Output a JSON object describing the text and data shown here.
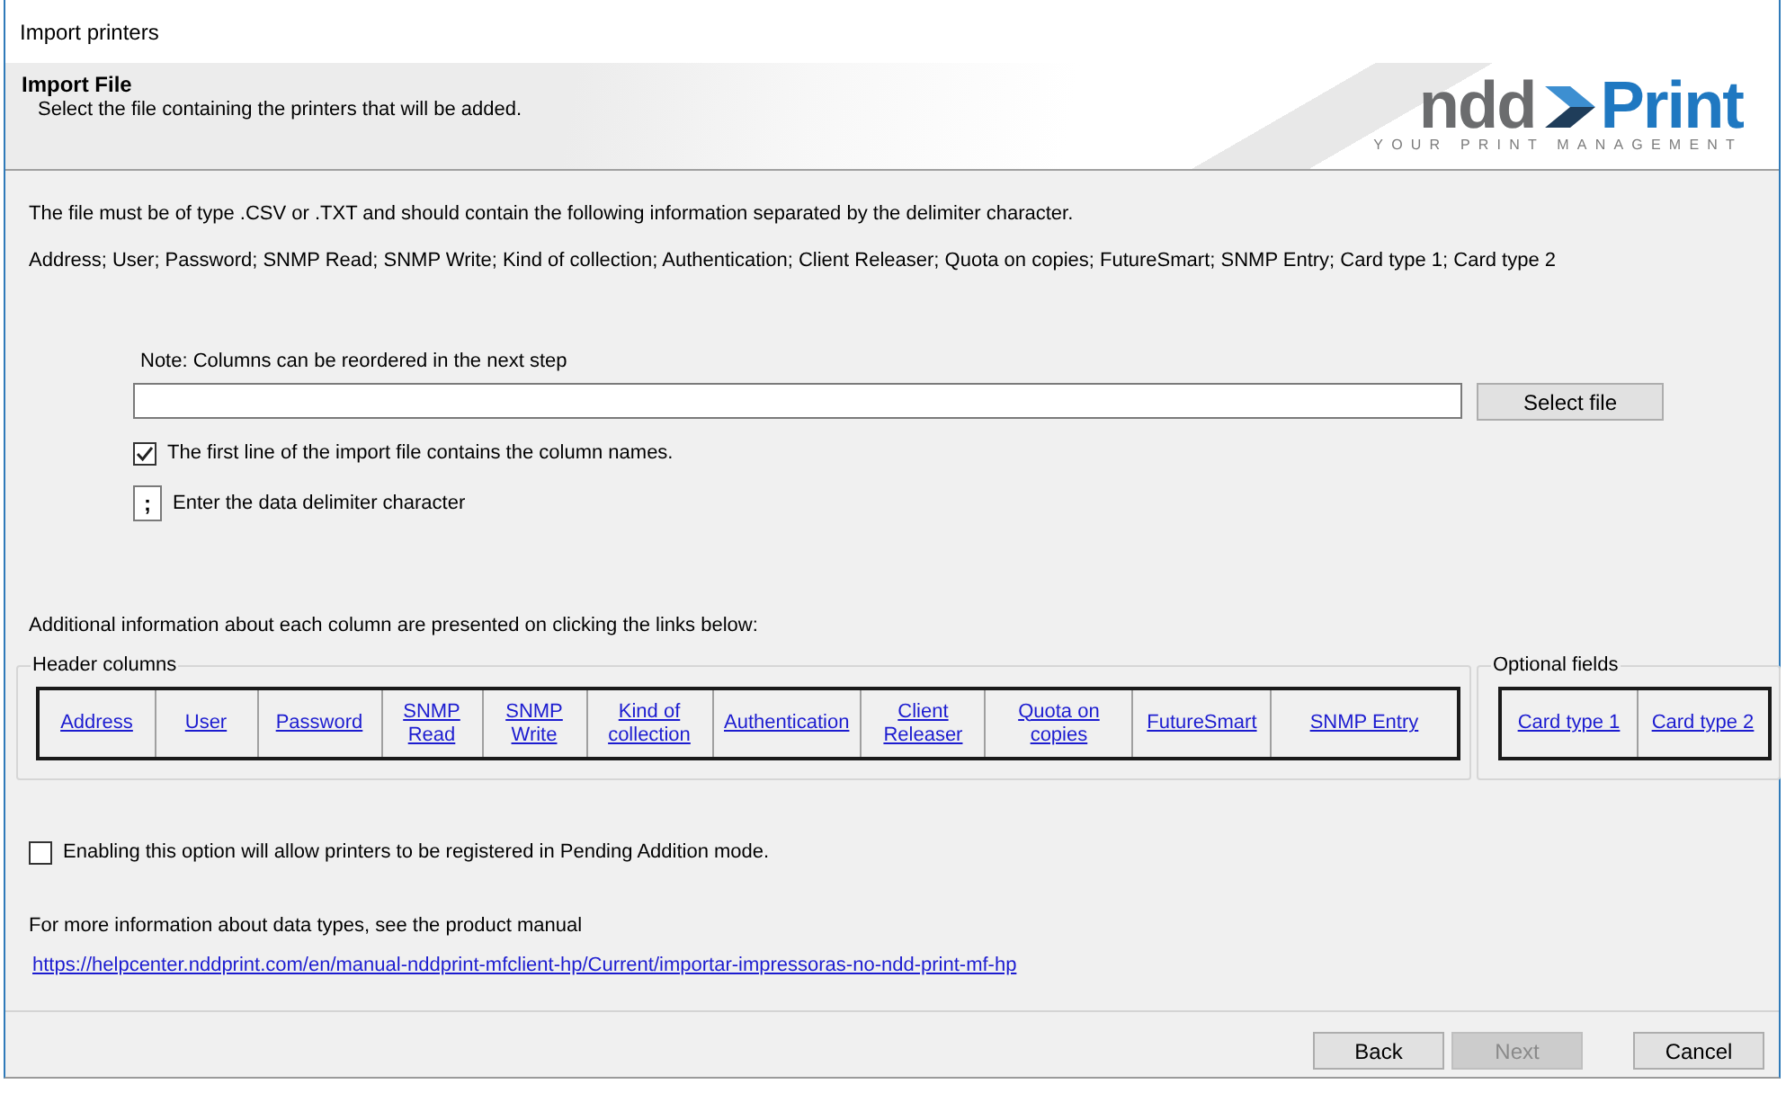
{
  "window": {
    "title": "Import printers"
  },
  "header": {
    "title": "Import File",
    "subtitle": "Select the file containing the printers that will be added.",
    "logo": {
      "word_1": "ndd",
      "word_2": "Print",
      "tagline": "YOUR PRINT MANAGEMENT"
    }
  },
  "intro": {
    "requirement": "The file must be of type .CSV or .TXT and should contain the following information separated by the delimiter character.",
    "fields_list": "Address; User; Password; SNMP Read; SNMP Write; Kind of collection; Authentication; Client Releaser; Quota on copies; FutureSmart; SNMP Entry; Card type 1; Card type 2"
  },
  "file": {
    "note": "Note: Columns can be reordered in the next step",
    "button": "Select file"
  },
  "first_line_header": {
    "label": "The first line of the import file contains the column names.",
    "checked": true
  },
  "delimiter": {
    "value": ";",
    "label": "Enter the data delimiter character"
  },
  "links_intro": "Additional information about each column are presented on clicking the links below:",
  "column_groups": [
    {
      "legend": "Header columns",
      "links": [
        "Address",
        "User",
        "Password",
        "SNMP Read",
        "SNMP Write",
        "Kind of collection",
        "Authentication",
        "Client Releaser",
        "Quota on copies",
        "FutureSmart",
        "SNMP Entry"
      ]
    },
    {
      "legend": "Optional fields",
      "links": [
        "Card type 1",
        "Card type 2"
      ]
    }
  ],
  "pending_addition": {
    "label": "Enabling this option will allow printers to be registered in Pending Addition mode.",
    "checked": false
  },
  "manual": {
    "text": "For more information about data types, see the product manual",
    "link": "https://helpcenter.nddprint.com/en/manual-nddprint-mfclient-hp/Current/importar-impressoras-no-ndd-print-mf-hp"
  },
  "buttons": [
    {
      "label": "Back",
      "disabled": false
    },
    {
      "label": "Next",
      "disabled": true
    },
    {
      "label": "Cancel",
      "disabled": false
    }
  ]
}
